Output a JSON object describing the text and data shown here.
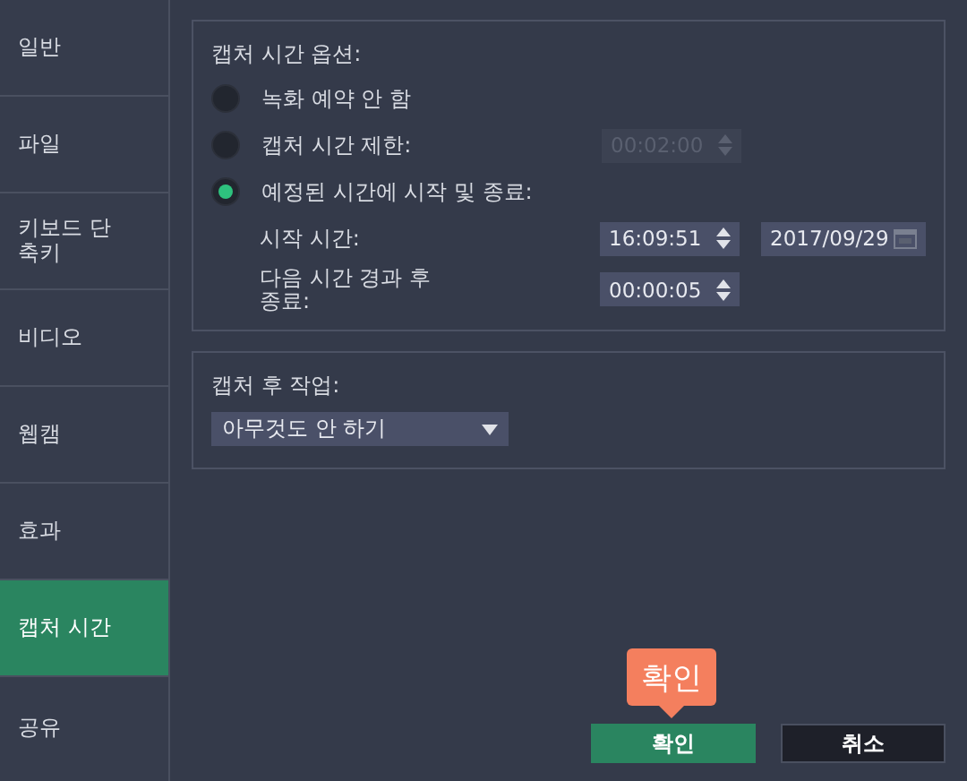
{
  "sidebar": {
    "items": [
      {
        "label": "일반",
        "selected": false
      },
      {
        "label": "파일",
        "selected": false
      },
      {
        "label": "키보드 단축키",
        "selected": false
      },
      {
        "label": "비디오",
        "selected": false
      },
      {
        "label": "웹캠",
        "selected": false
      },
      {
        "label": "효과",
        "selected": false
      },
      {
        "label": "캡처 시간",
        "selected": true
      },
      {
        "label": "공유",
        "selected": false
      }
    ]
  },
  "capture_time": {
    "title": "캡처 시간 옵션:",
    "options": [
      {
        "label": "녹화 예약 안 함",
        "selected": false
      },
      {
        "label": "캡처 시간 제한:",
        "selected": false,
        "field": {
          "value": "00:02:00",
          "disabled": true
        }
      },
      {
        "label": "예정된 시간에 시작 및 종료:",
        "selected": true
      }
    ],
    "start_time": {
      "label": "시작 시간:",
      "time": "16:09:51",
      "date": "2017/09/29"
    },
    "end_after": {
      "label": "다음 시간 경과 후 종료:",
      "value": "00:00:05"
    }
  },
  "after_capture": {
    "title": "캡처 후 작업:",
    "dropdown": {
      "value": "아무것도 안 하기"
    }
  },
  "tooltip": {
    "text": "확인"
  },
  "buttons": [
    {
      "label": "확인",
      "kind": "primary"
    },
    {
      "label": "취소",
      "kind": "secondary"
    }
  ]
}
